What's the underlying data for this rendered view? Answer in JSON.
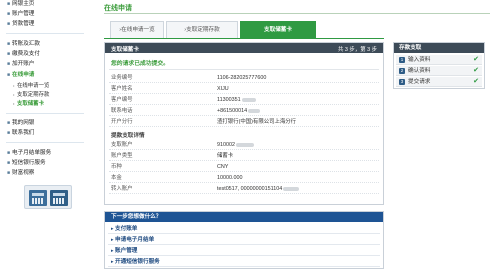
{
  "sidebar": {
    "top_items": [
      {
        "label": "网银主页"
      },
      {
        "label": "账户管理"
      },
      {
        "label": "贷款管理"
      }
    ],
    "mid_items": [
      {
        "label": "转账及汇款"
      },
      {
        "label": "缴费及支付"
      },
      {
        "label": "加开账户"
      },
      {
        "label": "在线申请"
      }
    ],
    "sub_items": [
      {
        "label": "在线申请一览"
      },
      {
        "label": "支取定期存款"
      },
      {
        "label": "支取储蓄卡"
      }
    ],
    "bottom_items": [
      {
        "label": "我的网银"
      },
      {
        "label": "联系我们"
      }
    ],
    "service_items": [
      {
        "label": "电子月结单服务"
      },
      {
        "label": "短信银行服务"
      },
      {
        "label": "财富视察"
      }
    ]
  },
  "page": {
    "title": "在线申请"
  },
  "tabs": [
    {
      "label": "在线申请一览"
    },
    {
      "label": "支取定期存款"
    },
    {
      "label": "支取储蓄卡"
    }
  ],
  "panel": {
    "header_title": "支取储蓄卡",
    "page_indicator": "共 3 步，第 3 步",
    "success_message": "您的请求已成功提交。",
    "rows_a": [
      {
        "label": "业务编号",
        "value": "1106-282025777600"
      },
      {
        "label": "客户姓名",
        "value": "XIJU"
      },
      {
        "label": "客户编号",
        "value": "11300351"
      },
      {
        "label": "联系电话",
        "value": "+861500014"
      },
      {
        "label": "开户分行",
        "value": "渣打银行(中国)有限公司上海分行"
      }
    ],
    "section_heading": "提款支取详情",
    "rows_b": [
      {
        "label": "支取账户",
        "value": "910002"
      },
      {
        "label": "账户类型",
        "value": "储蓄卡"
      },
      {
        "label": "币种",
        "value": "CNY"
      },
      {
        "label": "本金",
        "value": "10000.000"
      },
      {
        "label": "转入账户",
        "value": "test0517, 00000000151104"
      }
    ]
  },
  "steps_box": {
    "title": "存款支取",
    "steps": [
      {
        "num": "1",
        "label": "输入资料",
        "check": "✔"
      },
      {
        "num": "2",
        "label": "确认资料",
        "check": "✔"
      },
      {
        "num": "3",
        "label": "提交请求",
        "check": "✔"
      }
    ]
  },
  "next": {
    "title": "下一步您想做什么？",
    "links": [
      {
        "label": "支付账单"
      },
      {
        "label": "申请电子月结单"
      },
      {
        "label": "账户管理"
      },
      {
        "label": "开通短信银行服务"
      }
    ]
  },
  "colors": {
    "brand_green": "#2f9a42",
    "panel_header": "#3d4b58",
    "next_header": "#1e5494"
  }
}
